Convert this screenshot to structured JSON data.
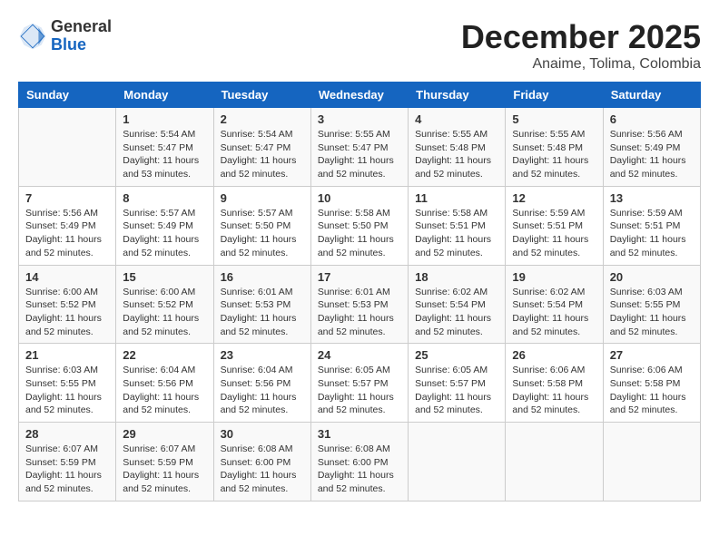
{
  "header": {
    "logo_general": "General",
    "logo_blue": "Blue",
    "main_title": "December 2025",
    "subtitle": "Anaime, Tolima, Colombia"
  },
  "days_of_week": [
    "Sunday",
    "Monday",
    "Tuesday",
    "Wednesday",
    "Thursday",
    "Friday",
    "Saturday"
  ],
  "weeks": [
    [
      {
        "day": "",
        "info": ""
      },
      {
        "day": "1",
        "info": "Sunrise: 5:54 AM\nSunset: 5:47 PM\nDaylight: 11 hours\nand 53 minutes."
      },
      {
        "day": "2",
        "info": "Sunrise: 5:54 AM\nSunset: 5:47 PM\nDaylight: 11 hours\nand 52 minutes."
      },
      {
        "day": "3",
        "info": "Sunrise: 5:55 AM\nSunset: 5:47 PM\nDaylight: 11 hours\nand 52 minutes."
      },
      {
        "day": "4",
        "info": "Sunrise: 5:55 AM\nSunset: 5:48 PM\nDaylight: 11 hours\nand 52 minutes."
      },
      {
        "day": "5",
        "info": "Sunrise: 5:55 AM\nSunset: 5:48 PM\nDaylight: 11 hours\nand 52 minutes."
      },
      {
        "day": "6",
        "info": "Sunrise: 5:56 AM\nSunset: 5:49 PM\nDaylight: 11 hours\nand 52 minutes."
      }
    ],
    [
      {
        "day": "7",
        "info": "Sunrise: 5:56 AM\nSunset: 5:49 PM\nDaylight: 11 hours\nand 52 minutes."
      },
      {
        "day": "8",
        "info": "Sunrise: 5:57 AM\nSunset: 5:49 PM\nDaylight: 11 hours\nand 52 minutes."
      },
      {
        "day": "9",
        "info": "Sunrise: 5:57 AM\nSunset: 5:50 PM\nDaylight: 11 hours\nand 52 minutes."
      },
      {
        "day": "10",
        "info": "Sunrise: 5:58 AM\nSunset: 5:50 PM\nDaylight: 11 hours\nand 52 minutes."
      },
      {
        "day": "11",
        "info": "Sunrise: 5:58 AM\nSunset: 5:51 PM\nDaylight: 11 hours\nand 52 minutes."
      },
      {
        "day": "12",
        "info": "Sunrise: 5:59 AM\nSunset: 5:51 PM\nDaylight: 11 hours\nand 52 minutes."
      },
      {
        "day": "13",
        "info": "Sunrise: 5:59 AM\nSunset: 5:51 PM\nDaylight: 11 hours\nand 52 minutes."
      }
    ],
    [
      {
        "day": "14",
        "info": "Sunrise: 6:00 AM\nSunset: 5:52 PM\nDaylight: 11 hours\nand 52 minutes."
      },
      {
        "day": "15",
        "info": "Sunrise: 6:00 AM\nSunset: 5:52 PM\nDaylight: 11 hours\nand 52 minutes."
      },
      {
        "day": "16",
        "info": "Sunrise: 6:01 AM\nSunset: 5:53 PM\nDaylight: 11 hours\nand 52 minutes."
      },
      {
        "day": "17",
        "info": "Sunrise: 6:01 AM\nSunset: 5:53 PM\nDaylight: 11 hours\nand 52 minutes."
      },
      {
        "day": "18",
        "info": "Sunrise: 6:02 AM\nSunset: 5:54 PM\nDaylight: 11 hours\nand 52 minutes."
      },
      {
        "day": "19",
        "info": "Sunrise: 6:02 AM\nSunset: 5:54 PM\nDaylight: 11 hours\nand 52 minutes."
      },
      {
        "day": "20",
        "info": "Sunrise: 6:03 AM\nSunset: 5:55 PM\nDaylight: 11 hours\nand 52 minutes."
      }
    ],
    [
      {
        "day": "21",
        "info": "Sunrise: 6:03 AM\nSunset: 5:55 PM\nDaylight: 11 hours\nand 52 minutes."
      },
      {
        "day": "22",
        "info": "Sunrise: 6:04 AM\nSunset: 5:56 PM\nDaylight: 11 hours\nand 52 minutes."
      },
      {
        "day": "23",
        "info": "Sunrise: 6:04 AM\nSunset: 5:56 PM\nDaylight: 11 hours\nand 52 minutes."
      },
      {
        "day": "24",
        "info": "Sunrise: 6:05 AM\nSunset: 5:57 PM\nDaylight: 11 hours\nand 52 minutes."
      },
      {
        "day": "25",
        "info": "Sunrise: 6:05 AM\nSunset: 5:57 PM\nDaylight: 11 hours\nand 52 minutes."
      },
      {
        "day": "26",
        "info": "Sunrise: 6:06 AM\nSunset: 5:58 PM\nDaylight: 11 hours\nand 52 minutes."
      },
      {
        "day": "27",
        "info": "Sunrise: 6:06 AM\nSunset: 5:58 PM\nDaylight: 11 hours\nand 52 minutes."
      }
    ],
    [
      {
        "day": "28",
        "info": "Sunrise: 6:07 AM\nSunset: 5:59 PM\nDaylight: 11 hours\nand 52 minutes."
      },
      {
        "day": "29",
        "info": "Sunrise: 6:07 AM\nSunset: 5:59 PM\nDaylight: 11 hours\nand 52 minutes."
      },
      {
        "day": "30",
        "info": "Sunrise: 6:08 AM\nSunset: 6:00 PM\nDaylight: 11 hours\nand 52 minutes."
      },
      {
        "day": "31",
        "info": "Sunrise: 6:08 AM\nSunset: 6:00 PM\nDaylight: 11 hours\nand 52 minutes."
      },
      {
        "day": "",
        "info": ""
      },
      {
        "day": "",
        "info": ""
      },
      {
        "day": "",
        "info": ""
      }
    ]
  ]
}
